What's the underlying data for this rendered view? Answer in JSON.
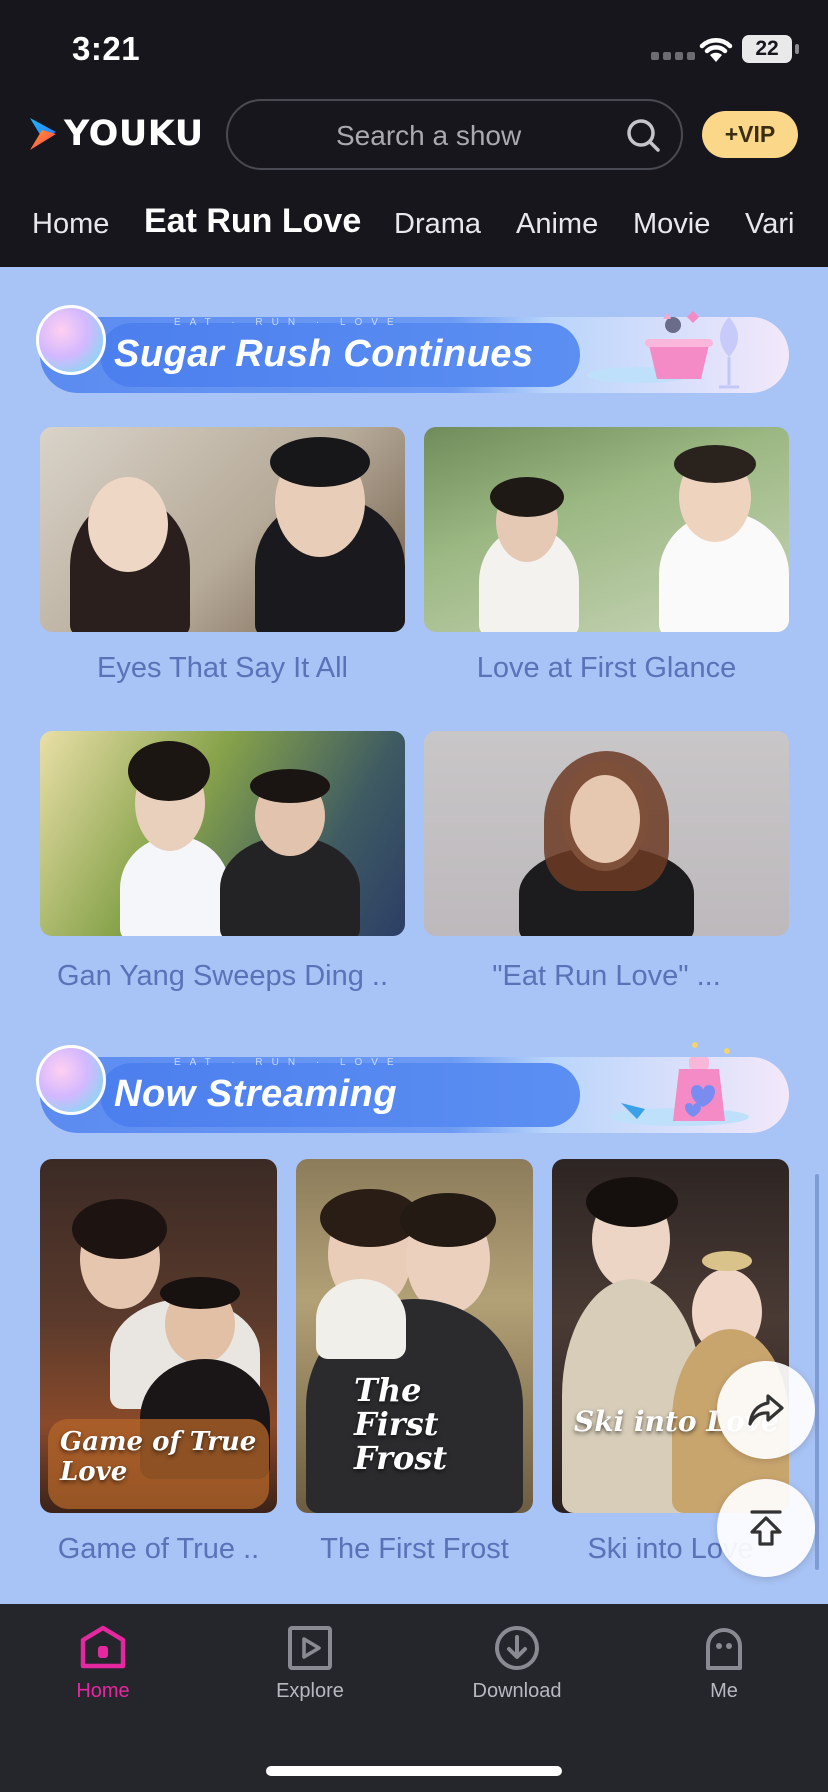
{
  "status_bar": {
    "time": "3:21",
    "battery": "22"
  },
  "header": {
    "logo_text": "YOUKU",
    "search_placeholder": "Search a show",
    "vip_label": "+VIP"
  },
  "tabs": [
    "Home",
    "Eat Run Love",
    "Drama",
    "Anime",
    "Movie",
    "Vari"
  ],
  "active_tab": "Eat Run Love",
  "sections": [
    {
      "subtitle": "EAT · RUN · LOVE",
      "title": "Sugar Rush Continues",
      "items": [
        {
          "title": "Eyes That Say It All"
        },
        {
          "title": "Love at First Glance"
        },
        {
          "title": "Gan Yang Sweeps Ding .."
        },
        {
          "title": "\"Eat Run Love\" ..."
        }
      ]
    },
    {
      "subtitle": "EAT · RUN · LOVE",
      "title": "Now Streaming",
      "items": [
        {
          "title": "Game of True ..",
          "poster_text": "Game of True Love"
        },
        {
          "title": "The First Frost",
          "poster_text": "The First Frost"
        },
        {
          "title": "Ski into Love",
          "poster_text": "Ski into Love"
        }
      ]
    }
  ],
  "bottom_nav": [
    {
      "label": "Home",
      "icon": "home-icon",
      "active": true
    },
    {
      "label": "Explore",
      "icon": "play-square-icon",
      "active": false
    },
    {
      "label": "Download",
      "icon": "download-icon",
      "active": false
    },
    {
      "label": "Me",
      "icon": "profile-icon",
      "active": false
    }
  ],
  "colors": {
    "accent": "#e4289f",
    "header_bg": "#16161c",
    "page_bg": "#a8c3f5",
    "vip_bg": "#fbd78a",
    "card_title": "#5a72b8"
  }
}
